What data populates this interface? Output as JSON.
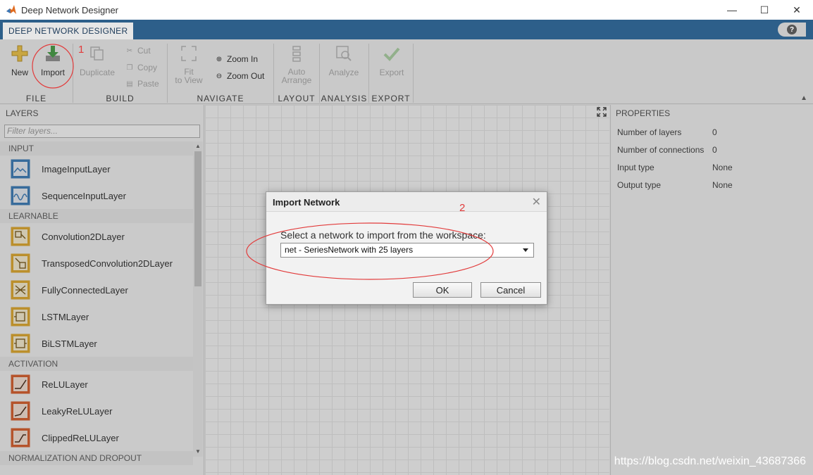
{
  "window": {
    "title": "Deep Network Designer",
    "controls": [
      "minimize",
      "maximize",
      "close"
    ]
  },
  "tabstrip": {
    "tab_label": "DEEP NETWORK DESIGNER",
    "help_label": "?"
  },
  "ribbon": {
    "file": {
      "label": "FILE",
      "new": "New",
      "import": "Import"
    },
    "build": {
      "label": "BUILD",
      "duplicate": "Duplicate",
      "cut": "Cut",
      "copy": "Copy",
      "paste": "Paste"
    },
    "navigate": {
      "label": "NAVIGATE",
      "fit_line1": "Fit",
      "fit_line2": "to View",
      "zoom_in": "Zoom In",
      "zoom_out": "Zoom Out"
    },
    "layout": {
      "label": "LAYOUT",
      "auto_line1": "Auto",
      "auto_line2": "Arrange"
    },
    "analysis": {
      "label": "ANALYSIS",
      "analyze": "Analyze"
    },
    "export": {
      "label": "EXPORT",
      "export": "Export"
    }
  },
  "layers_panel": {
    "title": "LAYERS",
    "filter_placeholder": "Filter layers...",
    "sections": [
      {
        "name": "INPUT",
        "items": [
          "ImageInputLayer",
          "SequenceInputLayer"
        ]
      },
      {
        "name": "LEARNABLE",
        "items": [
          "Convolution2DLayer",
          "TransposedConvolution2DLayer",
          "FullyConnectedLayer",
          "LSTMLayer",
          "BiLSTMLayer"
        ]
      },
      {
        "name": "ACTIVATION",
        "items": [
          "ReLULayer",
          "LeakyReLULayer",
          "ClippedReLULayer"
        ]
      },
      {
        "name": "NORMALIZATION AND DROPOUT",
        "items": []
      }
    ]
  },
  "properties_panel": {
    "title": "PROPERTIES",
    "rows": [
      {
        "label": "Number of layers",
        "value": "0"
      },
      {
        "label": "Number of connections",
        "value": "0"
      },
      {
        "label": "Input type",
        "value": "None"
      },
      {
        "label": "Output type",
        "value": "None"
      }
    ]
  },
  "dialog": {
    "title": "Import Network",
    "prompt": "Select a network to import from the workspace:",
    "selected": "net - SeriesNetwork with 25 layers",
    "ok": "OK",
    "cancel": "Cancel"
  },
  "annotations": {
    "marker1": "1",
    "marker2": "2",
    "color": "#e23b3b"
  },
  "watermark": "https://blog.csdn.net/weixin_43687366",
  "colors": {
    "tabstrip": "#2d5f8a",
    "learnable_icon": "#e0a520",
    "activation_icon": "#d8541e",
    "input_icon": "#2e74b5"
  }
}
